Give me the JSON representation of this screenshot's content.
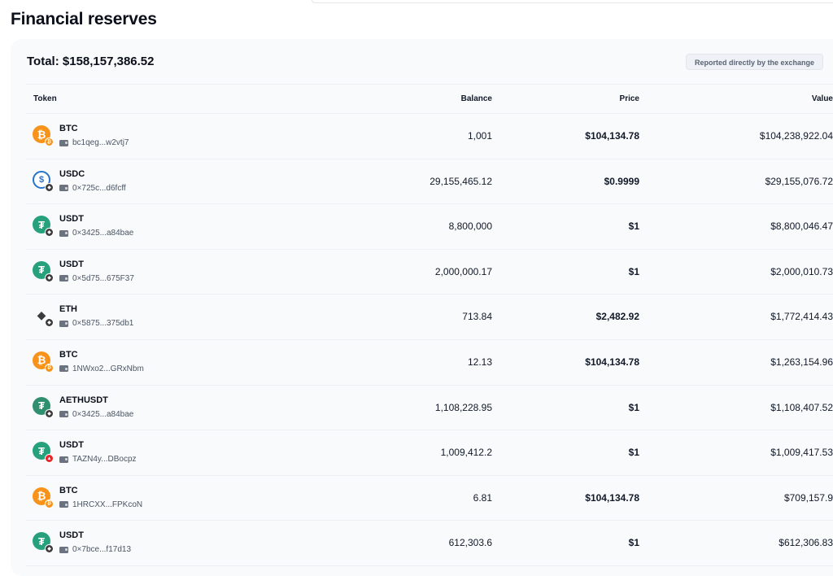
{
  "page": {
    "title": "Financial reserves"
  },
  "summary": {
    "total_label": "Total: $158,157,386.52",
    "reported_badge": "Reported directly by the exchange"
  },
  "table": {
    "columns": [
      "Token",
      "Balance",
      "Price",
      "Value"
    ],
    "rows": [
      {
        "symbol": "BTC",
        "address": "bc1qeg...w2vtj7",
        "balance": "1,001",
        "price": "$104,134.78",
        "value": "$104,238,922.04",
        "icon": "btc-icon",
        "chain_icon": "btc-chain-icon"
      },
      {
        "symbol": "USDC",
        "address": "0×725c...d6fcff",
        "balance": "29,155,465.12",
        "price": "$0.9999",
        "value": "$29,155,076.72",
        "icon": "usdc-icon",
        "chain_icon": "eth-chain-icon"
      },
      {
        "symbol": "USDT",
        "address": "0×3425...a84bae",
        "balance": "8,800,000",
        "price": "$1",
        "value": "$8,800,046.47",
        "icon": "usdt-icon",
        "chain_icon": "eth-chain-icon"
      },
      {
        "symbol": "USDT",
        "address": "0×5d75...675F37",
        "balance": "2,000,000.17",
        "price": "$1",
        "value": "$2,000,010.73",
        "icon": "usdt-icon",
        "chain_icon": "eth-chain-icon"
      },
      {
        "symbol": "ETH",
        "address": "0×5875...375db1",
        "balance": "713.84",
        "price": "$2,482.92",
        "value": "$1,772,414.43",
        "icon": "eth-icon",
        "chain_icon": "eth-chain-icon"
      },
      {
        "symbol": "BTC",
        "address": "1NWxo2...GRxNbm",
        "balance": "12.13",
        "price": "$104,134.78",
        "value": "$1,263,154.96",
        "icon": "btc-icon",
        "chain_icon": "btc-chain-icon"
      },
      {
        "symbol": "AETHUSDT",
        "address": "0×3425...a84bae",
        "balance": "1,108,228.95",
        "price": "$1",
        "value": "$1,108,407.52",
        "icon": "aethusdt-icon",
        "chain_icon": "eth-chain-icon"
      },
      {
        "symbol": "USDT",
        "address": "TAZN4y...DBocpz",
        "balance": "1,009,412.2",
        "price": "$1",
        "value": "$1,009,417.53",
        "icon": "usdt-icon",
        "chain_icon": "tron-chain-icon"
      },
      {
        "symbol": "BTC",
        "address": "1HRCXX...FPKcoN",
        "balance": "6.81",
        "price": "$104,134.78",
        "value": "$709,157.9",
        "icon": "btc-icon",
        "chain_icon": "btc-chain-icon"
      },
      {
        "symbol": "USDT",
        "address": "0×7bce...f17d13",
        "balance": "612,303.6",
        "price": "$1",
        "value": "$612,306.83",
        "icon": "usdt-icon",
        "chain_icon": "eth-chain-icon"
      }
    ]
  },
  "colors": {
    "btc": "#f7931a",
    "usdc": "#2775ca",
    "usdt": "#26a17b",
    "eth": "#3c3c3d",
    "aethusdt": "#2f8f6f",
    "tron": "#e5262b"
  }
}
